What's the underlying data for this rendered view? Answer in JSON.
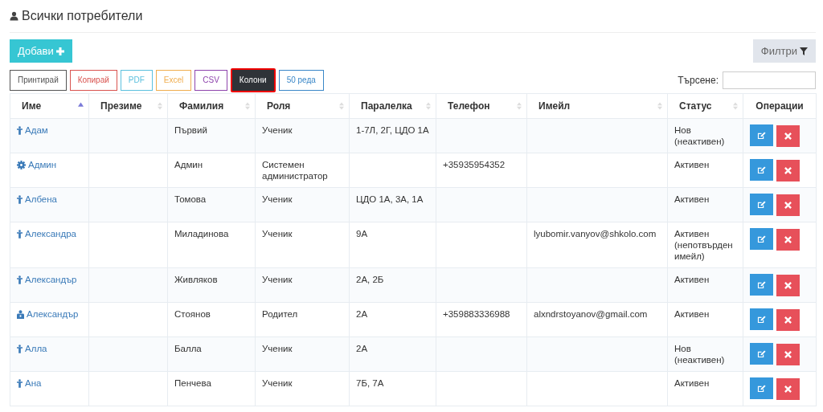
{
  "page": {
    "title": "Всички потребители"
  },
  "add_button": {
    "label": "Добави"
  },
  "filter_button": {
    "label": "Филтри"
  },
  "export_buttons": [
    {
      "label": "Принтирай",
      "color": "#555555",
      "selected": false
    },
    {
      "label": "Копирай",
      "color": "#d9534f",
      "selected": false
    },
    {
      "label": "PDF",
      "color": "#5bc0de",
      "selected": false
    },
    {
      "label": "Excel",
      "color": "#f0ad4e",
      "selected": false
    },
    {
      "label": "CSV",
      "color": "#8e44ad",
      "selected": false
    },
    {
      "label": "Колони",
      "color": "#2f3338",
      "selected": true
    },
    {
      "label": "50 реда",
      "color": "#3a87c8",
      "selected": false
    }
  ],
  "search": {
    "label": "Търсене:"
  },
  "table": {
    "columns": [
      {
        "label": "Име",
        "sorted": true
      },
      {
        "label": "Презиме",
        "sorted": false
      },
      {
        "label": "Фамилия",
        "sorted": false
      },
      {
        "label": "Роля",
        "sorted": false
      },
      {
        "label": "Паралелка",
        "sorted": false
      },
      {
        "label": "Телефон",
        "sorted": false
      },
      {
        "label": "Имейл",
        "sorted": false
      },
      {
        "label": "Статус",
        "sorted": false
      },
      {
        "label": "Операции"
      }
    ],
    "rows": [
      {
        "kind": "student",
        "cells": [
          "Адам",
          "",
          "Първий",
          "Ученик",
          "1-7Л, 2Г, ЦДО 1А",
          "",
          "",
          "Нов (неактивен)"
        ]
      },
      {
        "kind": "admin",
        "cells": [
          "Админ",
          "",
          "Админ",
          "Системен администратор",
          "",
          "+35935954352",
          "",
          "Активен"
        ]
      },
      {
        "kind": "student",
        "cells": [
          "Албена",
          "",
          "Томова",
          "Ученик",
          "ЦДО 1А, 3А, 1А",
          "",
          "",
          "Активен"
        ]
      },
      {
        "kind": "student",
        "cells": [
          "Александра",
          "",
          "Миладинова",
          "Ученик",
          "9А",
          "",
          "lyubomir.vanyov@shkolo.com",
          "Активен (непотвърден имейл)"
        ]
      },
      {
        "kind": "student",
        "cells": [
          "Александър",
          "",
          "Живляков",
          "Ученик",
          "2А, 2Б",
          "",
          "",
          "Активен"
        ]
      },
      {
        "kind": "parent",
        "cells": [
          "Александър",
          "",
          "Стоянов",
          "Родител",
          "2А",
          "+359883336988",
          "alxndrstoyanov@gmail.com",
          "Активен"
        ]
      },
      {
        "kind": "student",
        "cells": [
          "Алла",
          "",
          "Балла",
          "Ученик",
          "2А",
          "",
          "",
          "Нов (неактивен)"
        ]
      },
      {
        "kind": "student",
        "cells": [
          "Ана",
          "",
          "Пенчева",
          "Ученик",
          "7Б, 7А",
          "",
          "",
          "Активен"
        ]
      }
    ]
  }
}
